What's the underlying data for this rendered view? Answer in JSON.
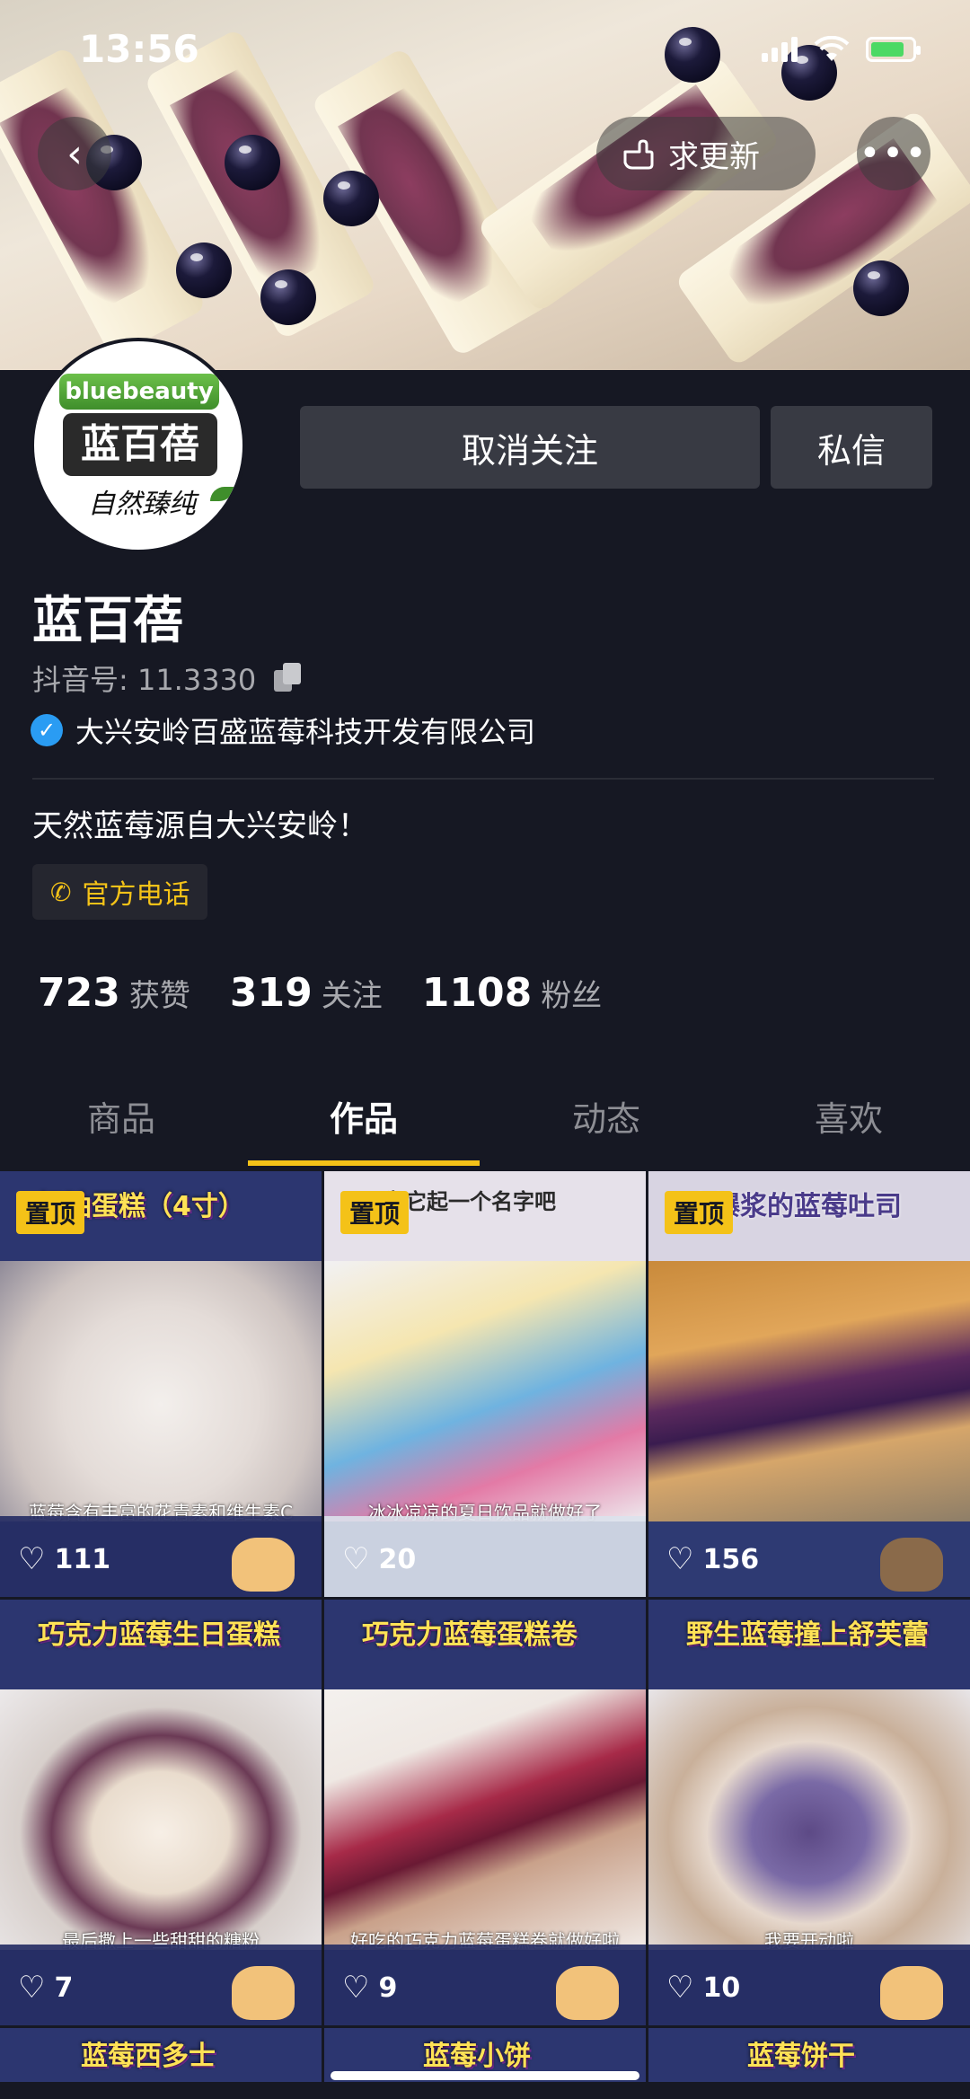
{
  "status_bar": {
    "time": "13:56"
  },
  "header": {
    "update_label": "求更新"
  },
  "profile": {
    "avatar": {
      "brand_en": "bluebeauty",
      "brand_cn": "蓝百蓓",
      "slogan": "自然臻纯"
    },
    "follow_button": "取消关注",
    "message_button": "私信",
    "name": "蓝百蓓",
    "douyin_id": "抖音号: 11.3330",
    "verified_text": "大兴安岭百盛蓝莓科技开发有限公司",
    "bio": "天然蓝莓源自大兴安岭！",
    "phone_label": "官方电话",
    "stats": [
      {
        "num": "723",
        "label": "获赞"
      },
      {
        "num": "319",
        "label": "关注"
      },
      {
        "num": "1108",
        "label": "粉丝"
      }
    ]
  },
  "tabs": [
    {
      "label": "商品"
    },
    {
      "label": "作品"
    },
    {
      "label": "动态"
    },
    {
      "label": "喜欢"
    }
  ],
  "pin_label": "置顶",
  "videos": [
    {
      "title": "奶油蛋糕（4寸）",
      "caption": "蓝莓含有丰富的花青素和维生素C",
      "likes": "111"
    },
    {
      "title": "区为它起一个名字吧",
      "caption": "冰冰凉凉的夏日饮品就做好了",
      "likes": "20"
    },
    {
      "title": "会爆浆的蓝莓吐司",
      "caption": "",
      "likes": "156"
    },
    {
      "title": "巧克力蓝莓生日蛋糕",
      "caption": "最后撒上一些甜甜的糖粉",
      "likes": "7"
    },
    {
      "title": "巧克力蓝莓蛋糕卷",
      "caption": "好吃的巧克力蓝莓蛋糕卷就做好啦",
      "likes": "9"
    },
    {
      "title": "野生蓝莓撞上舒芙蕾",
      "caption": "我要开动啦",
      "likes": "10"
    },
    {
      "title": "蓝莓西多士"
    },
    {
      "title": "蓝莓小饼"
    },
    {
      "title": "蓝莓饼干"
    }
  ],
  "colors": {
    "background": "#161823",
    "accent": "#f4c218",
    "button": "#383a43",
    "verified": "#2a9cf3"
  }
}
